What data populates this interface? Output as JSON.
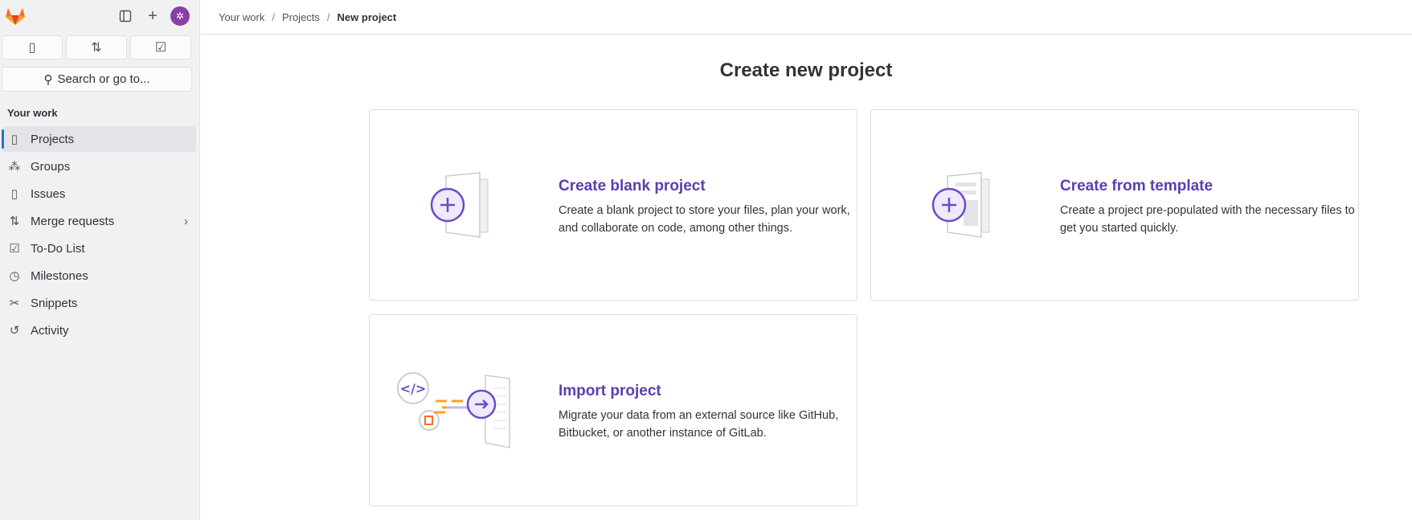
{
  "sidebar": {
    "search_placeholder": "Search or go to...",
    "section": "Your work",
    "items": [
      {
        "label": "Projects",
        "icon": "project-icon"
      },
      {
        "label": "Groups",
        "icon": "group-icon"
      },
      {
        "label": "Issues",
        "icon": "issues-icon"
      },
      {
        "label": "Merge requests",
        "icon": "merge-request-icon"
      },
      {
        "label": "To-Do List",
        "icon": "todo-icon"
      },
      {
        "label": "Milestones",
        "icon": "clock-icon"
      },
      {
        "label": "Snippets",
        "icon": "snippet-icon"
      },
      {
        "label": "Activity",
        "icon": "history-icon"
      }
    ]
  },
  "breadcrumb": [
    "Your work",
    "Projects",
    "New project"
  ],
  "page_title": "Create new project",
  "cards": [
    {
      "title": "Create blank project",
      "desc": "Create a blank project to store your files, plan your work, and collaborate on code, among other things."
    },
    {
      "title": "Create from template",
      "desc": "Create a project pre-populated with the necessary files to get you started quickly."
    },
    {
      "title": "Import project",
      "desc": "Migrate your data from an external source like GitHub, Bitbucket, or another instance of GitLab."
    }
  ],
  "colors": {
    "accent": "#5c3eb0",
    "brand": "#fc6d26",
    "active_bar": "#1f75cb"
  }
}
